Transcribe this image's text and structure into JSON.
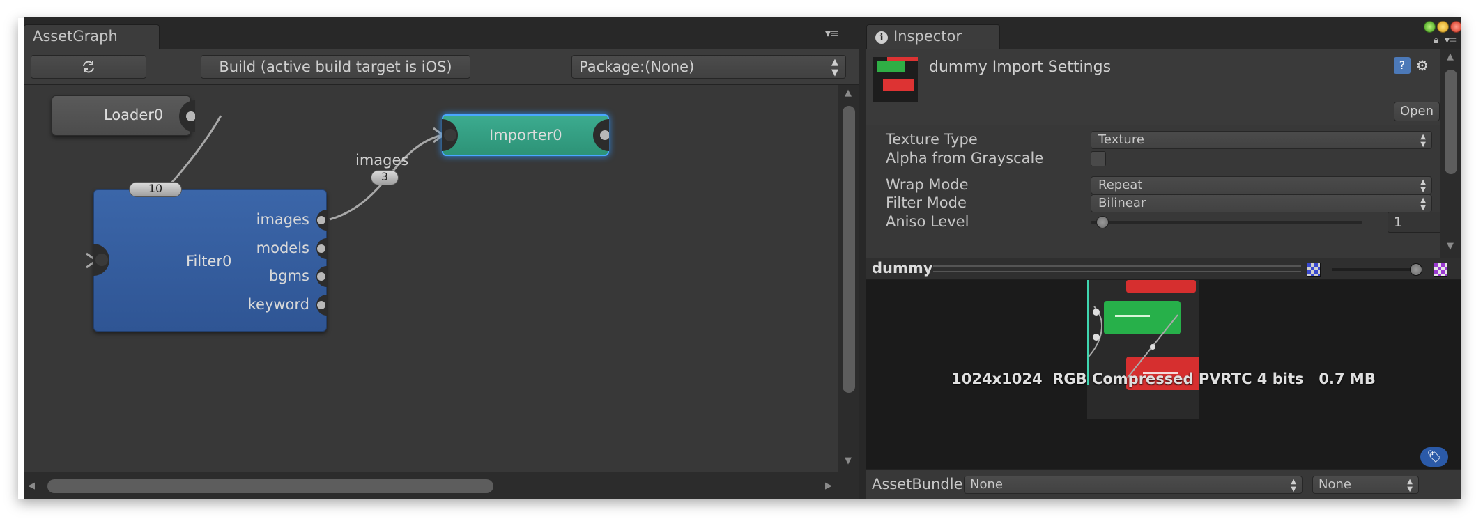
{
  "assetgraph": {
    "tab_title": "AssetGraph",
    "toolbar": {
      "refresh_icon": "refresh-icon",
      "build_label": "Build (active build target is iOS)",
      "package_label": "Package:(None)"
    },
    "nodes": {
      "loader": {
        "title": "Loader0"
      },
      "importer": {
        "title": "Importer0"
      },
      "filter": {
        "title": "Filter0",
        "outputs": [
          "images",
          "models",
          "bgms",
          "keyword"
        ]
      }
    },
    "connections": [
      {
        "label": "",
        "count": "10"
      },
      {
        "label": "images",
        "count": "3"
      }
    ]
  },
  "inspector": {
    "tab_title": "Inspector",
    "header": {
      "title": "dummy Import Settings",
      "open_label": "Open"
    },
    "properties": {
      "texture_type": {
        "label": "Texture Type",
        "value": "Texture"
      },
      "alpha_from_grayscale": {
        "label": "Alpha from Grayscale",
        "checked": false
      },
      "wrap_mode": {
        "label": "Wrap Mode",
        "value": "Repeat"
      },
      "filter_mode": {
        "label": "Filter Mode",
        "value": "Bilinear"
      },
      "aniso_level": {
        "label": "Aniso Level",
        "value": "1",
        "fraction": 0.0
      }
    },
    "preview": {
      "name": "dummy",
      "info": "1024x1024  RGB Compressed PVRTC 4 bits   0.7 MB"
    },
    "asset_bundle": {
      "label": "AssetBundle",
      "name_value": "None",
      "variant_value": "None"
    }
  },
  "colors": {
    "importer_node": "#35a084",
    "filter_node": "#345c9e",
    "loader_node": "#525252",
    "selection_glow": "#4aa6ff"
  }
}
